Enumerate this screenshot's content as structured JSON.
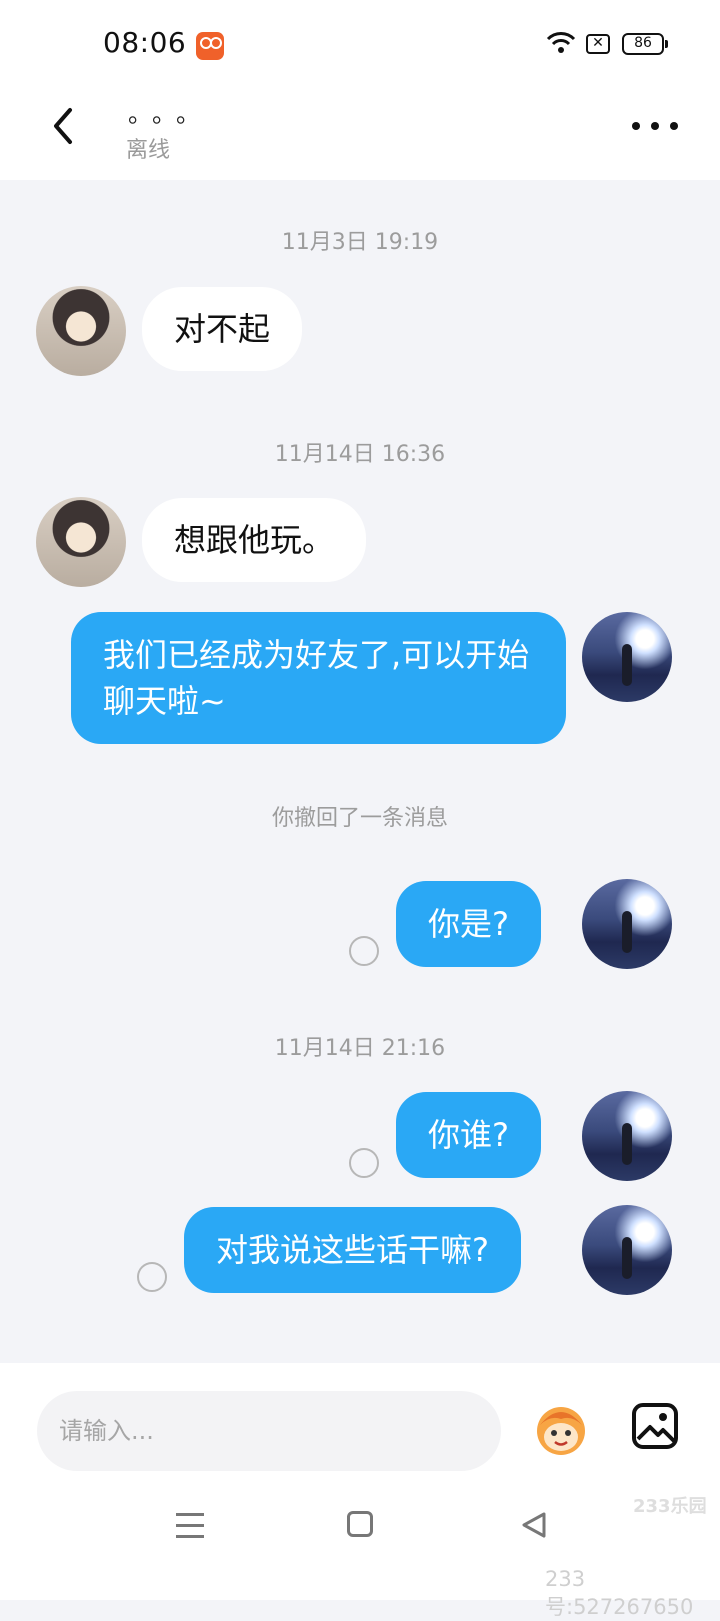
{
  "status_bar": {
    "time": "08:06",
    "battery": "86",
    "icons": [
      "app-badge-icon",
      "wifi-icon",
      "sim-off-icon",
      "battery-icon"
    ]
  },
  "header": {
    "title": "。。。",
    "subtitle": "离线",
    "back_icon": "chevron-left-icon",
    "more_icon": "more-horizontal-icon"
  },
  "messages": [
    {
      "type": "timestamp",
      "text": "11月3日 19:19"
    },
    {
      "type": "incoming",
      "text": "对不起"
    },
    {
      "type": "timestamp",
      "text": "11月14日 16:36"
    },
    {
      "type": "incoming",
      "text": "想跟他玩。"
    },
    {
      "type": "outgoing",
      "text": "我们已经成为好友了,可以开始聊天啦~"
    },
    {
      "type": "system",
      "text": "你撤回了一条消息"
    },
    {
      "type": "outgoing",
      "text": "你是?"
    },
    {
      "type": "timestamp",
      "text": "11月14日 21:16"
    },
    {
      "type": "outgoing",
      "text": "你谁?"
    },
    {
      "type": "outgoing",
      "text": "对我说这些话干嘛?"
    }
  ],
  "composer": {
    "placeholder": "请输入...",
    "emoji_icon": "sticker-icon",
    "image_icon": "image-icon"
  },
  "watermark": {
    "logo": "233乐园",
    "text": "233号:527267650"
  },
  "colors": {
    "outgoing_bubble": "#2aa8f5",
    "incoming_bubble": "#ffffff",
    "background": "#f3f4f8"
  }
}
